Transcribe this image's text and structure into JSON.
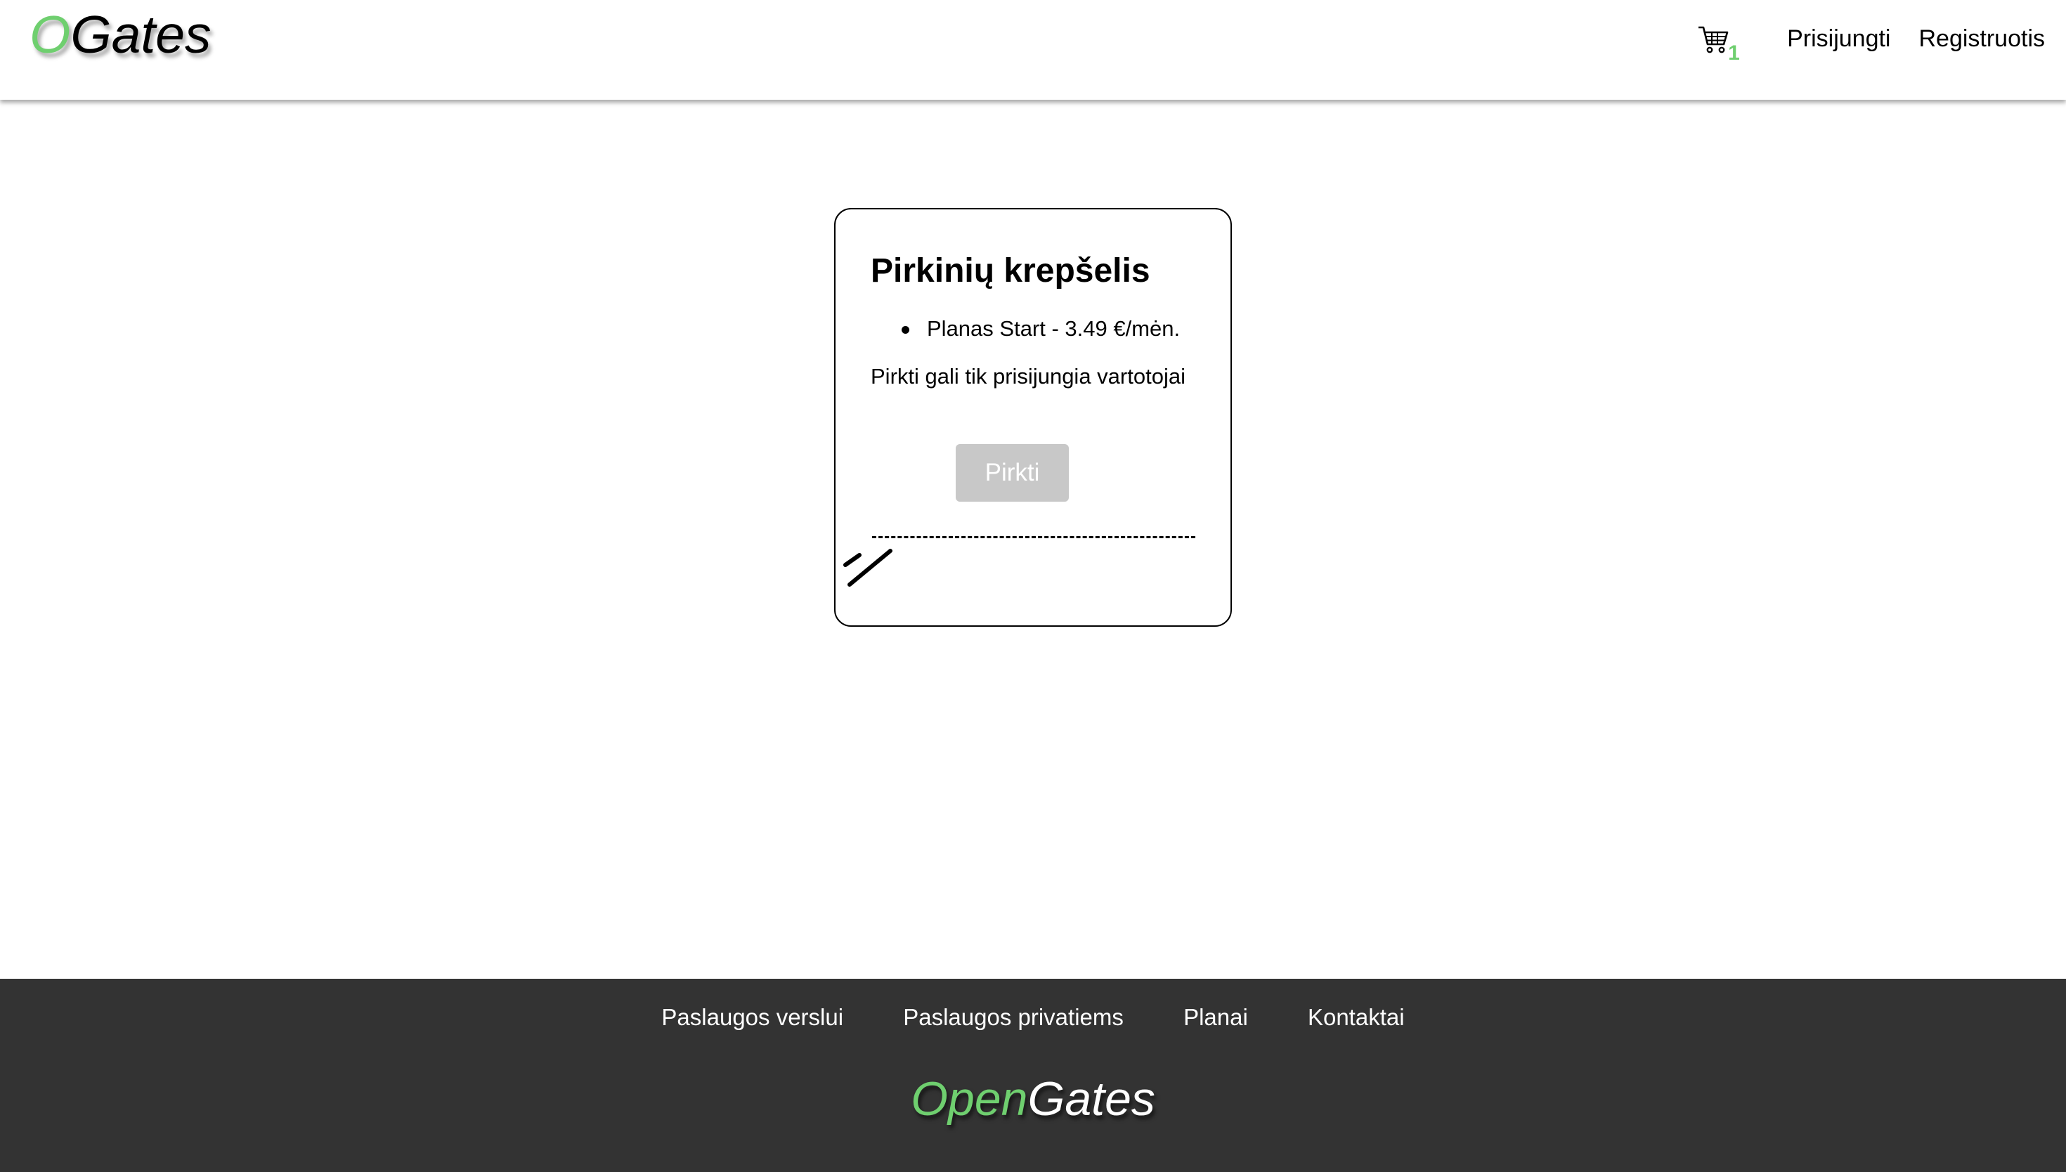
{
  "header": {
    "logo_accent": "O",
    "logo_rest": "Gates",
    "cart_count": "1",
    "login_label": "Prisijungti",
    "register_label": "Registruotis"
  },
  "cart": {
    "title": "Pirkinių krepšelis",
    "items": [
      {
        "label": "Planas Start - 3.49 €/mėn."
      }
    ],
    "note": "Pirkti gali tik prisijungia vartotojai",
    "buy_label": "Pirkti"
  },
  "footer": {
    "links": [
      {
        "label": "Paslaugos verslui"
      },
      {
        "label": "Paslaugos privatiems"
      },
      {
        "label": "Planai"
      },
      {
        "label": "Kontaktai"
      }
    ],
    "logo_accent": "Open",
    "logo_rest": "Gates"
  },
  "colors": {
    "accent": "#6fcf6f",
    "footer_bg": "#333333",
    "disabled_button": "#c8c8c8"
  },
  "icons": {
    "cart": "shopping-cart-icon",
    "resize": "resize-handle-icon"
  }
}
